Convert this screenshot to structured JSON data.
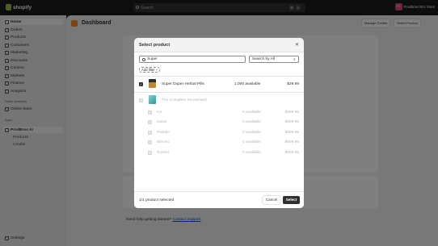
{
  "topbar": {
    "brand": "shopify",
    "search_placeholder": "Search",
    "shortcut_keys": [
      "⌘",
      "K"
    ],
    "store_initials": "PG",
    "store_name": "ProdBros DEV Store"
  },
  "sidebar": {
    "items": [
      {
        "label": "Home",
        "icon": "home-icon"
      },
      {
        "label": "Orders",
        "icon": "orders-icon"
      },
      {
        "label": "Products",
        "icon": "tag-icon"
      },
      {
        "label": "Customers",
        "icon": "person-icon"
      },
      {
        "label": "Marketing",
        "icon": "target-icon"
      },
      {
        "label": "Discounts",
        "icon": "discount-icon"
      },
      {
        "label": "Content",
        "icon": "content-icon"
      },
      {
        "label": "Markets",
        "icon": "globe-icon"
      },
      {
        "label": "Finance",
        "icon": "bank-icon"
      },
      {
        "label": "Analytics",
        "icon": "chart-icon"
      }
    ],
    "sales_channels_label": "Sales channels",
    "online_store_label": "Online Store",
    "apps_label": "Apps",
    "app_name": "ProdBros AI",
    "app_subitems": [
      "Products",
      "Credits"
    ],
    "settings_label": "Settings"
  },
  "main": {
    "title": "Dashboard",
    "manage_credits_label": "Manage Credits",
    "select_product_label": "Select Product",
    "footer_text": "Need help getting started?",
    "footer_link": "Contact Support"
  },
  "modal": {
    "title": "Select product",
    "search_value": "Super",
    "sort_label": "Search by All",
    "add_filter_label": "Add filter +",
    "products": [
      {
        "name": "Super Duper Herbal Pills",
        "available": "1,000 available",
        "price": "$29.99",
        "checked": true,
        "disabled": false
      },
      {
        "name": "The Complete Snowboard",
        "available": "",
        "price": "",
        "checked": false,
        "disabled": true
      }
    ],
    "variants": [
      {
        "name": "Ice",
        "available": "0 available",
        "price": "$699.95"
      },
      {
        "name": "Dawn",
        "available": "0 available",
        "price": "$699.95"
      },
      {
        "name": "Powder",
        "available": "0 available",
        "price": "$699.95"
      },
      {
        "name": "Electric",
        "available": "0 available",
        "price": "$699.95"
      },
      {
        "name": "Sunset",
        "available": "0 available",
        "price": "$699.95"
      }
    ],
    "selected_count": "1/1 product selected",
    "cancel_label": "Cancel",
    "select_label": "Select"
  }
}
